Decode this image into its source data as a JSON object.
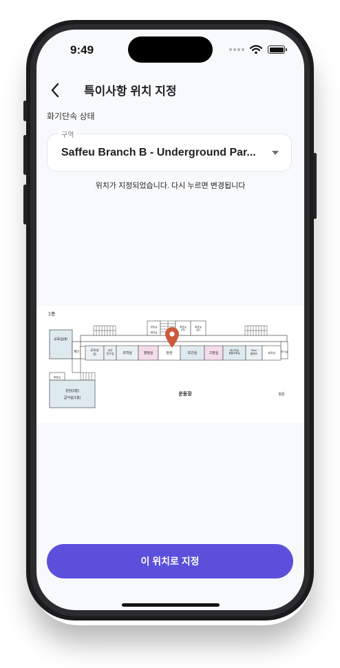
{
  "status_bar": {
    "time": "9:49"
  },
  "header": {
    "title": "특이사항 위치 지정"
  },
  "form": {
    "section_label": "화기단속 상태",
    "zone_legend": "구역",
    "zone_value": "Saffeu Branch B - Underground Par...",
    "hint": "위치가 지정되었습니다. 다시 누르면 변경됩니다"
  },
  "map": {
    "floor_label": "1층",
    "rooms": {
      "tl_room": "교육실(Ⅱ)",
      "stairs": "계단",
      "edu1": "교육실\n(Ⅰ)",
      "teacher": "교무\n연구실",
      "science": "과학실",
      "admin": "행정실",
      "entrance": "현관",
      "health": "보건실",
      "storage": "고장실",
      "special": "특수학급\n통합교육실",
      "wee": "Wee\n클래스",
      "roomA": "방송실",
      "roomB": "회의실",
      "roomC": "화장실\n(여)",
      "roomD": "화장실\n(남)",
      "roomE": "자료실",
      "roomF": "전기실",
      "hall_small": "화장실",
      "cafeteria": "급식실(1층)",
      "lounge": "강당(2층)",
      "playground": "운동장",
      "gate": "정문"
    },
    "pin_color": "#cc5a3a"
  },
  "actions": {
    "confirm_label": "이 위치로 지정"
  },
  "colors": {
    "accent": "#5b4fdc"
  }
}
